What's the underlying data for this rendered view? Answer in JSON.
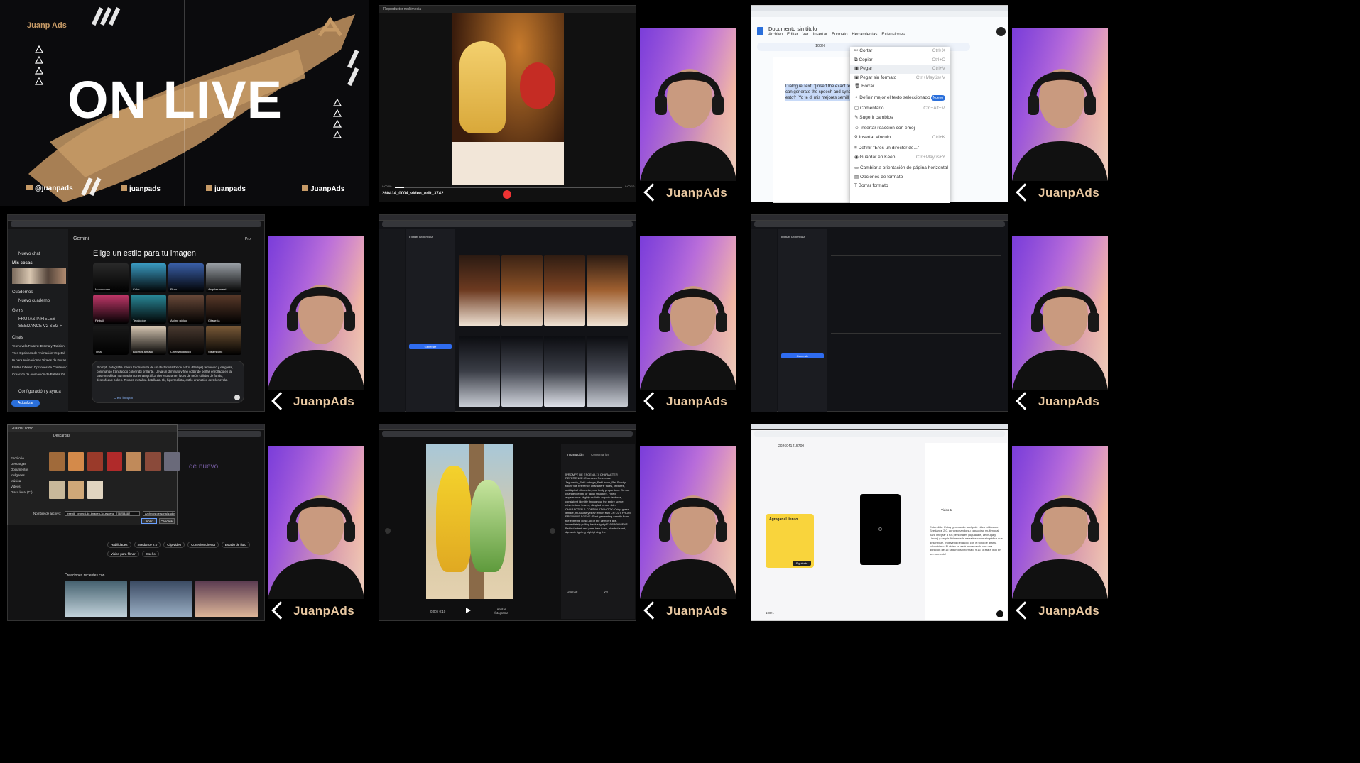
{
  "live": {
    "brand_top": "Juanp Ads",
    "headline": "ON LIVE",
    "socials": [
      "@juanpads",
      "juanpads_",
      "juanpads_",
      "JuanpAds"
    ]
  },
  "brand": "JuanpAds",
  "video_player": {
    "title": "Reproductor multimedia",
    "filename": "260414_0004_video_edit_3742",
    "time_start": "0:00:00",
    "time_end": "0:00:10"
  },
  "docs": {
    "doc_title": "Documento sin título",
    "menus": [
      "Archivo",
      "Editar",
      "Ver",
      "Insertar",
      "Formato",
      "Herramientas",
      "Extensiones"
    ],
    "zoom": "100%",
    "body_text": "Dialogue Text: \"[Insert the exact te can generate the speech and sync esto? ¡Yo te di mis mejores semill",
    "context_menu": [
      {
        "label": "Cortar",
        "shortcut": "Ctrl+X"
      },
      {
        "label": "Copiar",
        "shortcut": "Ctrl+C"
      },
      {
        "label": "Pegar",
        "shortcut": "Ctrl+V"
      },
      {
        "label": "Pegar sin formato",
        "shortcut": "Ctrl+Mayús+V"
      },
      {
        "label": "Borrar",
        "shortcut": ""
      },
      {
        "label": "Definir mejor el texto seleccionado",
        "shortcut": "Nuevo"
      },
      {
        "label": "Comentario",
        "shortcut": "Ctrl+Alt+M"
      },
      {
        "label": "Sugerir cambios",
        "shortcut": ""
      },
      {
        "label": "Insertar reacción con emoji",
        "shortcut": ""
      },
      {
        "label": "Insertar vínculo",
        "shortcut": "Ctrl+K"
      },
      {
        "label": "Definir \"Eres un director de...\"",
        "shortcut": "Ctrl+Mayús+Y"
      },
      {
        "label": "Guardar en Keep",
        "shortcut": ""
      },
      {
        "label": "Cambiar a orientación de página horizontal",
        "shortcut": ""
      },
      {
        "label": "Opciones de formato",
        "shortcut": ""
      },
      {
        "label": "Borrar formato",
        "shortcut": ""
      }
    ]
  },
  "gemini": {
    "app": "Gemini",
    "heading": "Elige un estilo para tu imagen",
    "sidebar": [
      "Nuevo chat",
      "Mis cosas",
      "Cuadernos",
      "Nuevo cuaderno",
      "Gems",
      "FRUTAS INFIELES",
      "SEEDANCE V2 SEG F",
      "Chats",
      "Telenovela Frutera: Drama y Traición",
      "Tres Opciones de Animación Vegetal",
      "IA para Animaciones Virales de Frutas",
      "Frutas Infieles: Opciones de Contenido",
      "Creación de Animación de Batalla Vir...",
      "Configuración y ayuda",
      "Actualizar"
    ],
    "styles": [
      "Monocromo",
      "Color",
      "Pluto",
      "Angeles marxi",
      "Pinball",
      "Tecnicolor",
      "Anime gótico",
      "Gitanería",
      "Tinta",
      "Bocetos a mano",
      "Cinematográfico",
      "Steampunk"
    ],
    "prompt": "Prompt: Fotografía macro fotorrealista de un destornillador de estría (Phillips) femenino y elegante, con mango translúcido color rubí brillante. Lleva un diminuto y fino collar de perlas enrollado en la base metálica. Iluminación cinematográfica de restaurante, luces de neón cálidas de fondo, desenfoque bokeh. Textura metálica detallada, 8k, hiperrealista, estilo dramático de telenovela.",
    "button": "Crear imagen",
    "mode": "Pro"
  },
  "freepik": {
    "panel_title": "Image Generator",
    "generate": "Generate"
  },
  "explorer": {
    "title": "Guardar como",
    "folder": "Descargas",
    "sidebar": [
      "Escritorio",
      "Descargas",
      "Documentos",
      "Imágenes",
      "Música",
      "Videos",
      "Disco local (C:)"
    ],
    "filename_label": "Nombre de archivo:",
    "filename": "freepik_prompt-de-imagen-3d-escena_278254882",
    "type": "Archivos personalizados",
    "open": "Abrir",
    "cancel": "Cancelar",
    "suggestions": [
      "Habilidades",
      "Seedance 2.0",
      "Clip video",
      "Conexión directa",
      "Estado de flujo",
      "Vision para filmar",
      "Diseño"
    ],
    "section": "Creaciones recientes con",
    "headline": "de nuevo"
  },
  "video2": {
    "tabs": [
      "Información",
      "Comentarios"
    ],
    "text": "[PROMPT DE ESCENA 1]: CHARACTER REFERENCE: Character Reference: Jaguarete_Ref Lechuga_Ref Limon_Ref Strictly follow the reference characters' faces, textures, outfit/pixel silhouette, and body proportions. Do not change identity or facial structure. Fixed appearance: Highly realistic organic textures, consistent identity throughout the entire scene, crisp lettuce leaves, dimpled lemon skin. CHARACTER & CONTINUITY HOOK: Crisp green lettuce, muscular yellow lemon MATCH CUT FROM PREVIOUS SCENE: Start generating exactly from the extreme close-up of the Lemon's lips, immediately pulling back slightly ENVIRONMENT: Behind a textured palm tree trunk, shaded sand, dynamic lighting highlighting the",
    "time": "0:00 / 0:10",
    "action": "Anotar fotograma",
    "buttons": [
      "Guardar",
      "Ver"
    ]
  },
  "capcut": {
    "id": "2026041415700",
    "card_title": "Agregar al lienzo",
    "card_btn": "Siguiente",
    "zoom": "100%",
    "right_text": "Entendido. Estoy generando tu clip de video utilizando Seedance 2.0, aprovechando su capacidad multimodal para integrar a tus personajes (Aguacate, Lechuga y Limón) y seguir fielmente la narrativa cinematográfica que describiste, incluyendo el audio con el tono de drama colombiano. El video se está procesando con una duración de 15 segundos y formato 9:16. ¡Estará listo en un momento!",
    "video_label": "Video 1"
  }
}
